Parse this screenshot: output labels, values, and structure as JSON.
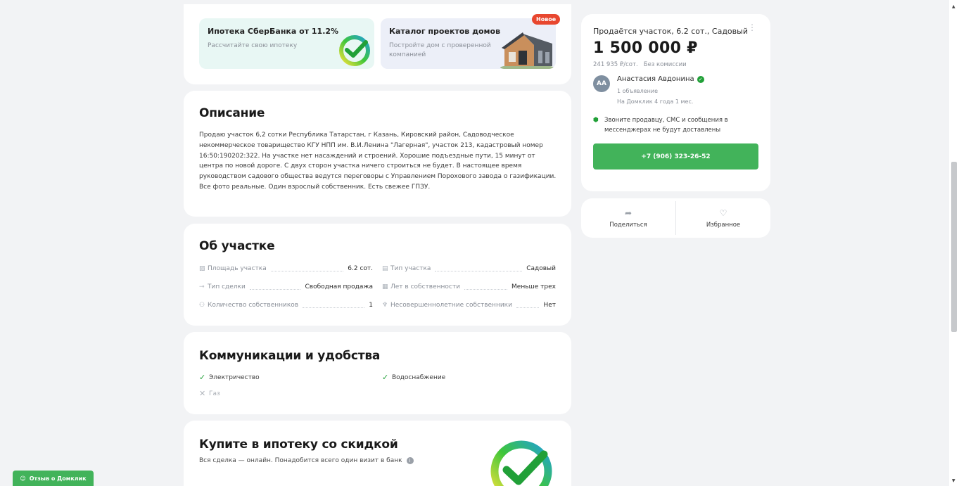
{
  "promo": {
    "sber": {
      "title": "Ипотека СберБанка от 11.2%",
      "subtitle": "Рассчитайте свою ипотеку"
    },
    "catalog": {
      "title": "Каталог проектов домов",
      "subtitle": "Постройте дом с проверенной компанией",
      "badge": "Новое"
    }
  },
  "description": {
    "heading": "Описание",
    "text": "Продаю участок 6,2 сотки Республика Татарстан, г Казань, Кировский район, Садоводческое некоммерческое товарищество КГУ НПП им. В.И.Ленина \"Лагерная\", участок 213, кадастровый номер 16:50:190202:322. На участке нет насаждений и строений. Хорошие подъездные пути, 15 минут от центра по новой дороге. С двух сторон участка ничего строиться не будет. В настоящее время руководством садового общества ведутся переговоры с Управлением Порохового завода о газификации. Все фото реальные. Один взрослый собственник. Есть свежее ГПЗУ."
  },
  "about": {
    "heading": "Об участке",
    "props": [
      {
        "label": "Площадь участка",
        "value": "6.2 сот.",
        "icon": "area-icon"
      },
      {
        "label": "Тип участка",
        "value": "Садовый",
        "icon": "plot-type-icon"
      },
      {
        "label": "Тип сделки",
        "value": "Свободная продажа",
        "icon": "key-icon"
      },
      {
        "label": "Лет в собственности",
        "value": "Меньше трех",
        "icon": "calendar-icon"
      },
      {
        "label": "Количество собственников",
        "value": "1",
        "icon": "people-icon"
      },
      {
        "label": "Несовершеннолетние собственники",
        "value": "Нет",
        "icon": "child-icon"
      }
    ]
  },
  "communications": {
    "heading": "Коммуникации и удобства",
    "items": [
      {
        "label": "Электричество",
        "available": true
      },
      {
        "label": "Водоснабжение",
        "available": true
      },
      {
        "label": "Газ",
        "available": false
      }
    ]
  },
  "mortgage": {
    "heading": "Купите в ипотеку со скидкой",
    "subtitle": "Вся сделка — онлайн. Понадобится всего один визит в банк"
  },
  "seller": {
    "title": "Продаётся участок, 6.2 сот., Садовый",
    "price": "1 500 000 ₽",
    "meta": "241 935 ₽/сот.   Без комиссии",
    "agent_initials": "АА",
    "agent_name": "Анастасия Авдонина",
    "agent_listings": "1 объявление",
    "agent_since": "На Домклик 4 года 1 мес.",
    "notice": "Звоните продавцу, СМС и сообщения в мессенджерах не будут доставлены",
    "phone": "+7 (906) 323-26-52"
  },
  "actions": {
    "share": "Поделиться",
    "favorite": "Избранное"
  },
  "feedback": {
    "label": "Отзыв о Домклик"
  },
  "colors": {
    "accent": "#42b35a",
    "brand_green": "#21a038",
    "badge": "#e8472f"
  }
}
